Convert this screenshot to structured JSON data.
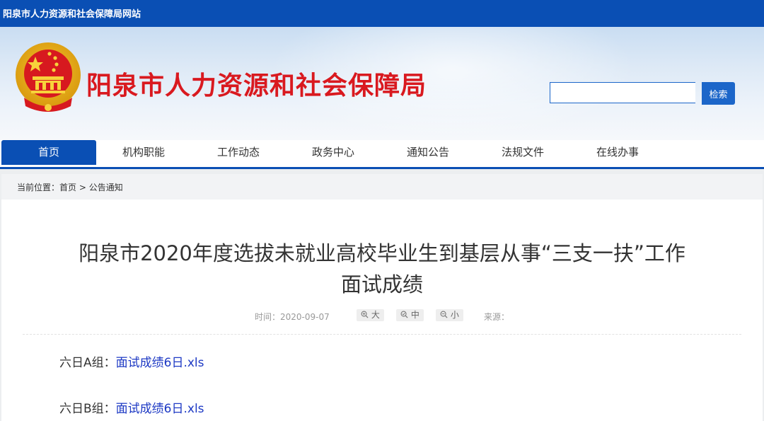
{
  "site": {
    "top_name": "阳泉市人力资源和社会保障局网站",
    "bureau_title": "阳泉市人力资源和社会保障局"
  },
  "search": {
    "placeholder": "",
    "button_label": "检索"
  },
  "nav": {
    "items": [
      {
        "label": "首页",
        "active": true
      },
      {
        "label": "机构职能"
      },
      {
        "label": "工作动态"
      },
      {
        "label": "政务中心"
      },
      {
        "label": "通知公告"
      },
      {
        "label": "法规文件"
      },
      {
        "label": "在线办事"
      }
    ]
  },
  "breadcrumb": {
    "prefix": "当前位置：",
    "home": "首页",
    "separator": ">",
    "current": "公告通知"
  },
  "article": {
    "title_line1": "阳泉市2020年度选拔未就业高校毕业生到基层从事“三支一扶”工作",
    "title_line2": "面试成绩",
    "date_label": "时间：2020-09-07",
    "zoom_large": "大",
    "zoom_medium": "中",
    "zoom_small": "小",
    "source_label": "来源：",
    "files": [
      {
        "group": "六日A组：",
        "link": "面试成绩6日.xls"
      },
      {
        "group": "六日B组：",
        "link": "面试成绩6日.xls"
      }
    ]
  },
  "colors": {
    "brand_blue": "#0a4fb4",
    "title_red": "#d9191f",
    "link_blue": "#1d39c4"
  },
  "icons": [
    "national-emblem-icon",
    "zoom-in-icon",
    "zoom-reset-icon",
    "zoom-out-icon"
  ]
}
